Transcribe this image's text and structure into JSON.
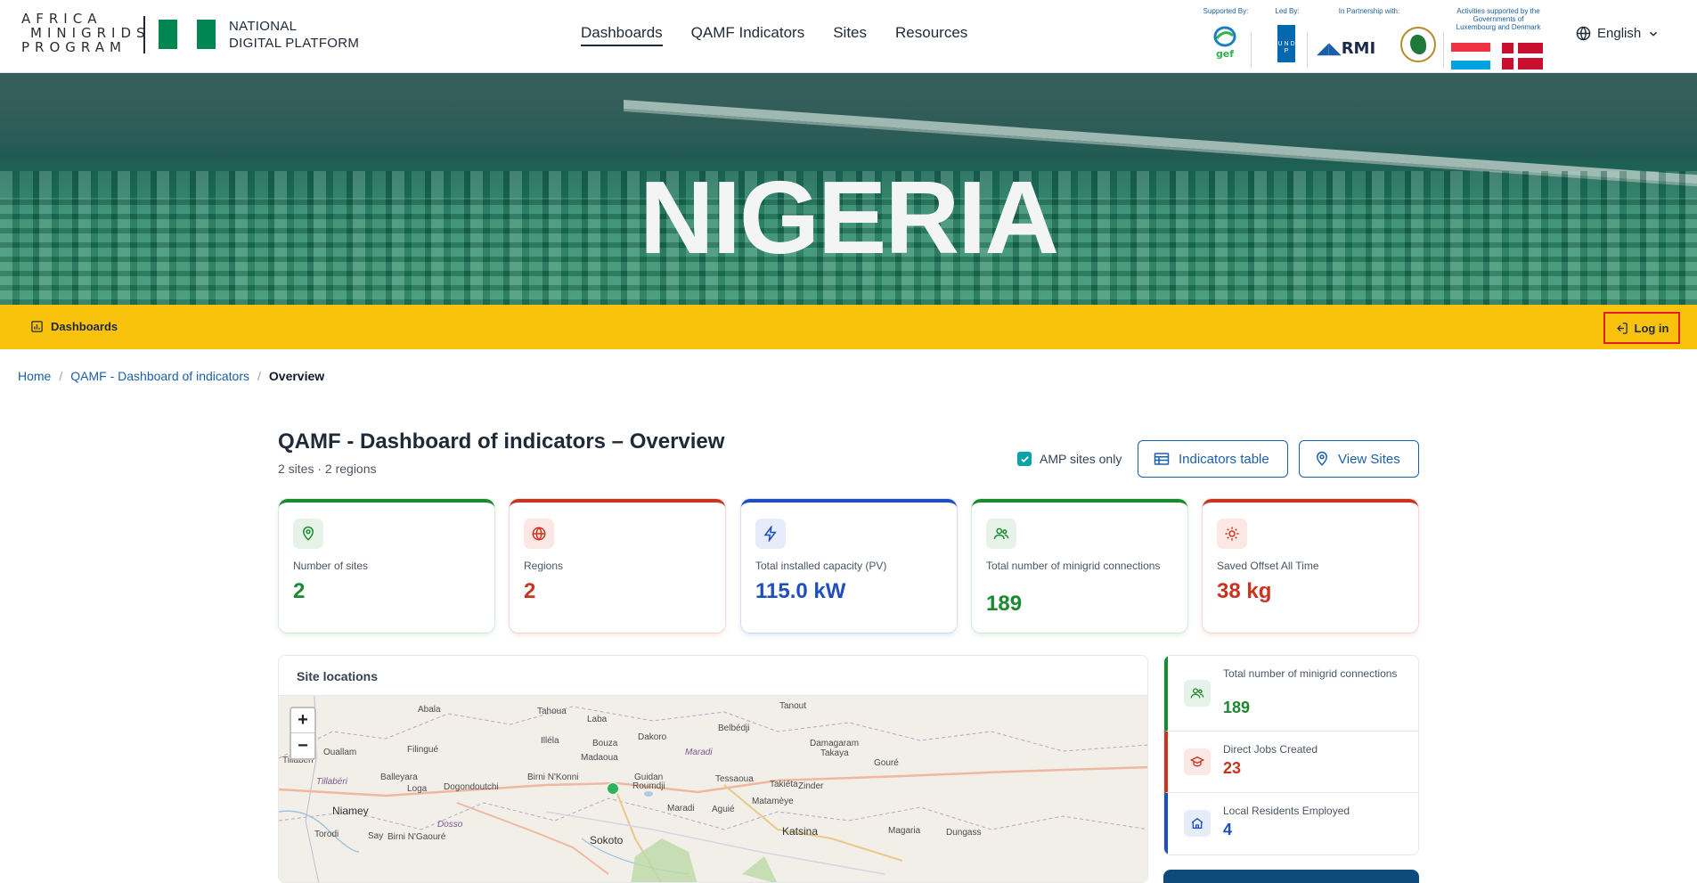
{
  "brand": {
    "logo_lines": [
      "AFRICA",
      "MINIGRIDS",
      "PROGRAM"
    ],
    "platform_line1": "NATIONAL",
    "platform_line2": "DIGITAL PLATFORM"
  },
  "nav": {
    "items": [
      {
        "label": "Dashboards",
        "active": true
      },
      {
        "label": "QAMF Indicators",
        "active": false
      },
      {
        "label": "Sites",
        "active": false
      },
      {
        "label": "Resources",
        "active": false
      }
    ]
  },
  "partners": {
    "supported_by": "Supported By:",
    "led_by": "Led By:",
    "partnership": "In Partnership with:",
    "activities_line1": "Activities supported by the",
    "activities_line2": "Governments of",
    "activities_line3": "Luxembourg and Denmark",
    "gef_text": "gef",
    "undp_text": "U N D P",
    "rmi_text": "RMI"
  },
  "language": {
    "label": "English"
  },
  "hero": {
    "title": "NIGERIA"
  },
  "subbar": {
    "dashboards_label": "Dashboards",
    "login_label": "Log in"
  },
  "breadcrumb": {
    "home": "Home",
    "section": "QAMF - Dashboard of indicators",
    "current": "Overview"
  },
  "page": {
    "title": "QAMF - Dashboard of indicators – Overview",
    "subtitle": "2 sites · 2 regions",
    "amp_only_label": "AMP sites only",
    "amp_only_checked": true,
    "indicators_btn": "Indicators table",
    "view_sites_btn": "View Sites"
  },
  "kpis": [
    {
      "label": "Number of sites",
      "value": "2",
      "color": "green",
      "icon": "map-pin-icon"
    },
    {
      "label": "Regions",
      "value": "2",
      "color": "red",
      "icon": "globe-icon"
    },
    {
      "label": "Total installed capacity (PV)",
      "value": "115.0 kW",
      "color": "blue",
      "icon": "lightning-icon"
    },
    {
      "label": "Total number of minigrid connections",
      "value": "189",
      "color": "green",
      "icon": "users-icon"
    },
    {
      "label": "Saved Offset All Time",
      "value": "38 kg",
      "color": "red",
      "icon": "sun-icon"
    }
  ],
  "map": {
    "title": "Site locations",
    "zoom_in": "+",
    "zoom_out": "−",
    "places": [
      "Abala",
      "Tahoua",
      "Tanout",
      "Laba",
      "Belbédji",
      "Illéla",
      "Bouza",
      "Dakoro",
      "Damagaram",
      "Takaya",
      "Ouallam",
      "Filingué",
      "Madaoua",
      "Maradi",
      "Gouré",
      "Tillabéri",
      "Balleyara",
      "Loga",
      "Dogondoutchi",
      "Birni N'Konni",
      "Guidan",
      "Roumdji",
      "Tessaoua",
      "Takiéta",
      "Zinder",
      "Tillabéri",
      "Niamey",
      "Dosso",
      "Maradi",
      "Aguié",
      "Matamèye",
      "Torodi",
      "Say",
      "Birni N'Gaouré",
      "Sokoto",
      "Katsina",
      "Magaria",
      "Dungass"
    ]
  },
  "side_stats": [
    {
      "label": "Total number of minigrid connections",
      "value": "189",
      "color": "green",
      "icon": "users-icon"
    },
    {
      "label": "Direct Jobs Created",
      "value": "23",
      "color": "red",
      "icon": "graduation-cap-icon"
    },
    {
      "label": "Local Residents Employed",
      "value": "4",
      "color": "blue",
      "icon": "home-icon"
    }
  ],
  "colors": {
    "green": "#1a8a2e",
    "red": "#c8341f",
    "blue": "#1e4fbf",
    "accent_yellow": "#f9c20d",
    "link_blue": "#1a5fa8",
    "nigeria_green": "#008751"
  }
}
